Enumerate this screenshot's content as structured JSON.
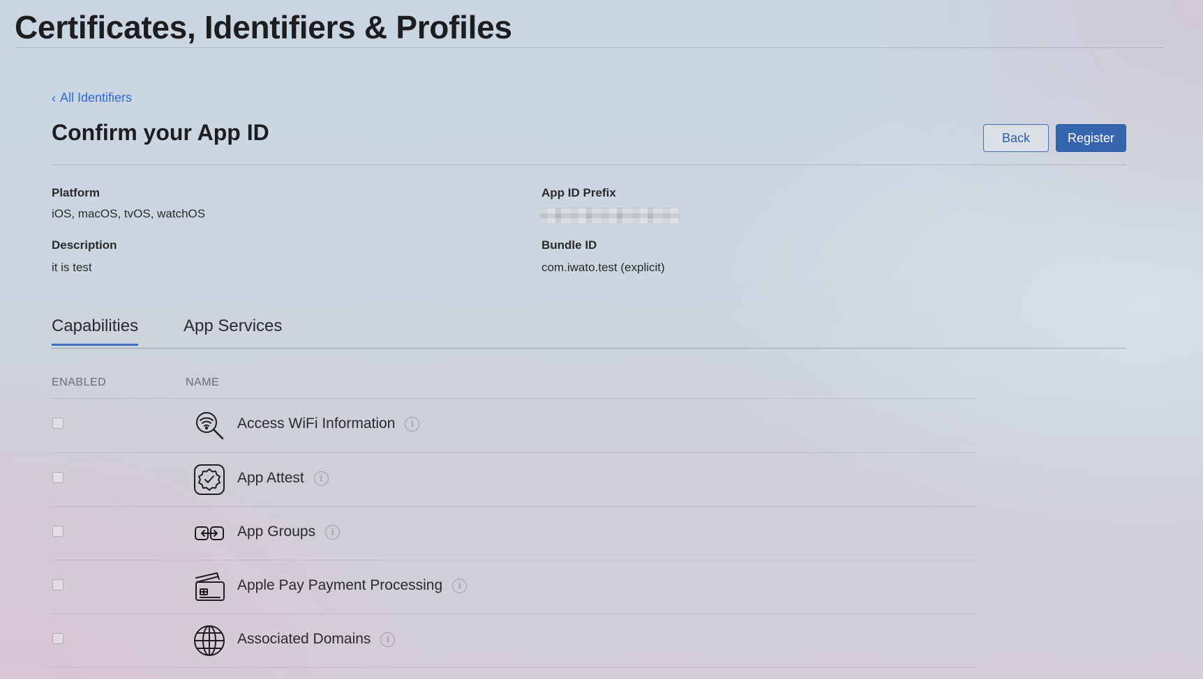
{
  "header": {
    "title": "Certificates, Identifiers & Profiles"
  },
  "breadcrumb": {
    "back_label": "All Identifiers"
  },
  "page": {
    "title": "Confirm your App ID",
    "back_button": "Back",
    "register_button": "Register"
  },
  "details": {
    "platform_label": "Platform",
    "platform_value": "iOS, macOS, tvOS, watchOS",
    "description_label": "Description",
    "description_value": "it is test",
    "prefix_label": "App ID Prefix",
    "bundle_label": "Bundle ID",
    "bundle_value": "com.iwato.test (explicit)"
  },
  "tabs": [
    {
      "label": "Capabilities",
      "active": true
    },
    {
      "label": "App Services",
      "active": false
    }
  ],
  "table": {
    "col_enabled": "ENABLED",
    "col_name": "NAME",
    "rows": [
      {
        "name": "Access WiFi Information",
        "icon": "wifi-search-icon",
        "enabled": false
      },
      {
        "name": "App Attest",
        "icon": "badge-check-icon",
        "enabled": false
      },
      {
        "name": "App Groups",
        "icon": "app-groups-icon",
        "enabled": false
      },
      {
        "name": "Apple Pay Payment Processing",
        "icon": "payment-cards-icon",
        "enabled": false
      },
      {
        "name": "Associated Domains",
        "icon": "globe-icon",
        "enabled": false
      }
    ]
  },
  "colors": {
    "accent": "#3565ac",
    "link": "#2f6ad2",
    "tab_indicator": "#3c6fc0"
  }
}
